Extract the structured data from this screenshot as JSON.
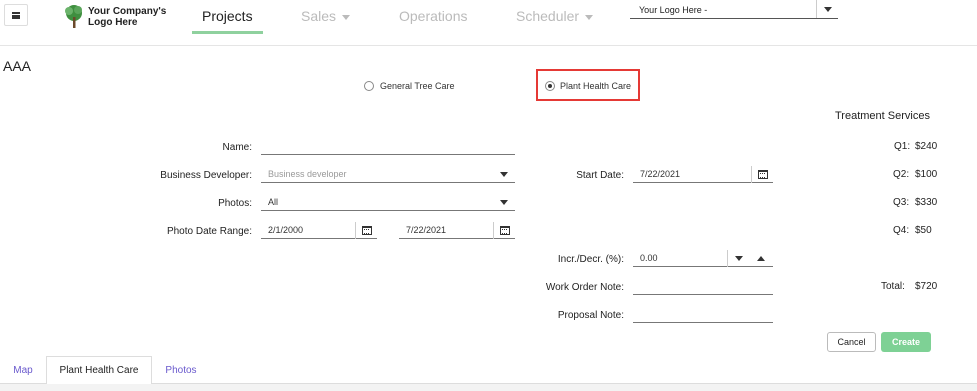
{
  "header": {
    "logo_line1": "Your Company's",
    "logo_line2": "Logo Here",
    "nav": [
      {
        "label": "Projects"
      },
      {
        "label": "Sales"
      },
      {
        "label": "Operations"
      },
      {
        "label": "Scheduler"
      }
    ],
    "logo_select_value": "Your Logo Here -"
  },
  "page": {
    "title": "AAA"
  },
  "care_type": {
    "options": [
      "General Tree Care",
      "Plant Health Care"
    ],
    "selected": "Plant Health Care"
  },
  "form": {
    "name_label": "Name:",
    "name_value": "",
    "business_developer_label": "Business Developer:",
    "business_developer_placeholder": "Business developer",
    "photos_label": "Photos:",
    "photos_value": "All",
    "photo_date_range_label": "Photo Date Range:",
    "photo_date_from": "2/1/2000",
    "photo_date_to": "7/22/2021",
    "start_date_label": "Start Date:",
    "start_date_value": "7/22/2021",
    "incr_decr_label": "Incr./Decr. (%):",
    "incr_decr_value": "0.00",
    "work_order_note_label": "Work Order Note:",
    "proposal_note_label": "Proposal Note:"
  },
  "treatment_services": {
    "title": "Treatment Services",
    "rows": [
      {
        "label": "Q1:",
        "value": "$240"
      },
      {
        "label": "Q2:",
        "value": "$100"
      },
      {
        "label": "Q3:",
        "value": "$330"
      },
      {
        "label": "Q4:",
        "value": "$50"
      }
    ],
    "total_label": "Total:",
    "total_value": "$720"
  },
  "actions": {
    "cancel": "Cancel",
    "create": "Create"
  },
  "bottom_tabs": [
    {
      "label": "Map"
    },
    {
      "label": "Plant Health Care"
    },
    {
      "label": "Photos"
    }
  ],
  "colors": {
    "accent_green": "#7ed195",
    "tab_link": "#6a5acd",
    "highlight_red": "#e53935"
  }
}
